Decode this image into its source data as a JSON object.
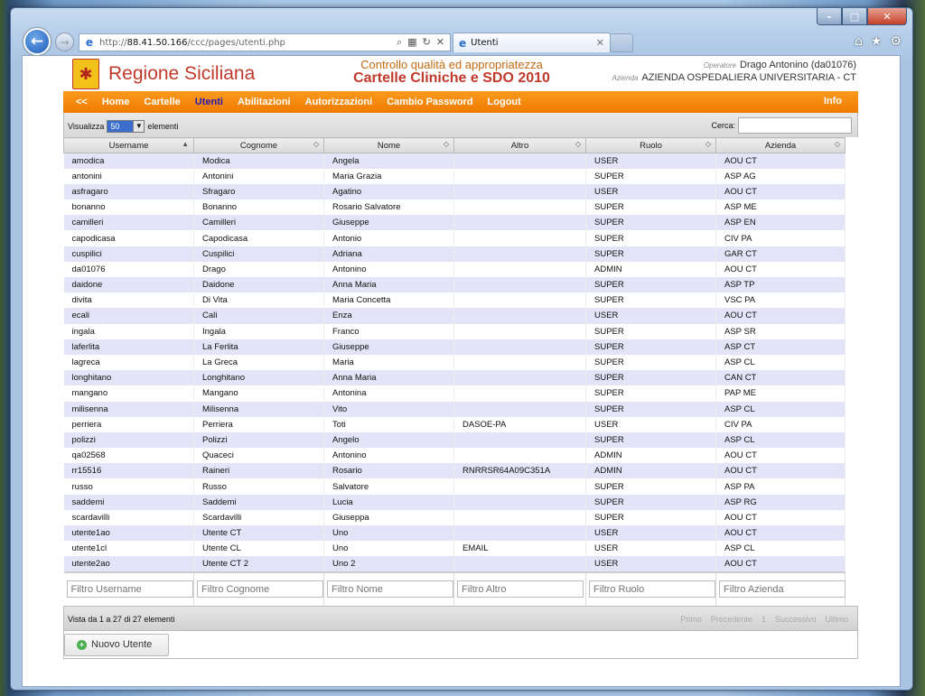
{
  "browser": {
    "url_prefix": "http://",
    "url_host": "88.41.50.166",
    "url_path": "/ccc/pages/utenti.php",
    "tab_title": "Utenti",
    "win_min": "–",
    "win_max": "□",
    "win_close": "✕"
  },
  "header": {
    "region": "Regione Siciliana",
    "title_line1": "Controllo qualità ed appropriatezza",
    "title_line2": "Cartelle Cliniche e SDO 2010",
    "operator_label": "Operatore",
    "operator": "Drago Antonino (da01076)",
    "azienda_label": "Azienda",
    "azienda": "AZIENDA OSPEDALIERA UNIVERSITARIA - CT"
  },
  "menu": {
    "items": [
      "<<",
      "Home",
      "Cartelle",
      "Utenti",
      "Abilitazioni",
      "Autorizzazioni",
      "Cambio Password",
      "Logout"
    ],
    "info": "Info"
  },
  "toolbar": {
    "show_label": "Visualizza",
    "page_size": "50",
    "elements_label": "elementi",
    "search_label": "Cerca:",
    "search_value": ""
  },
  "table": {
    "columns": [
      "Username",
      "Cognome",
      "Nome",
      "Altro",
      "Ruolo",
      "Azienda"
    ],
    "rows": [
      [
        "amodica",
        "Modica",
        "Angela",
        "",
        "USER",
        "AOU CT"
      ],
      [
        "antonini",
        "Antonini",
        "Maria Grazia",
        "",
        "SUPER",
        "ASP AG"
      ],
      [
        "asfragaro",
        "Sfragaro",
        "Agatino",
        "",
        "USER",
        "AOU CT"
      ],
      [
        "bonanno",
        "Bonanno",
        "Rosario Salvatore",
        "",
        "SUPER",
        "ASP ME"
      ],
      [
        "camilleri",
        "Camilleri",
        "Giuseppe",
        "",
        "SUPER",
        "ASP EN"
      ],
      [
        "capodicasa",
        "Capodicasa",
        "Antonio",
        "",
        "SUPER",
        "CIV PA"
      ],
      [
        "cuspilici",
        "Cuspilici",
        "Adriana",
        "",
        "SUPER",
        "GAR CT"
      ],
      [
        "da01076",
        "Drago",
        "Antonino",
        "",
        "ADMIN",
        "AOU CT"
      ],
      [
        "daidone",
        "Daidone",
        "Anna Maria",
        "",
        "SUPER",
        "ASP TP"
      ],
      [
        "divita",
        "Di Vita",
        "Maria Concetta",
        "",
        "SUPER",
        "VSC PA"
      ],
      [
        "ecali",
        "Calì",
        "Enza",
        "",
        "USER",
        "AOU CT"
      ],
      [
        "ingala",
        "Ingala",
        "Franco",
        "",
        "SUPER",
        "ASP SR"
      ],
      [
        "laferlita",
        "La Ferlita",
        "Giuseppe",
        "",
        "SUPER",
        "ASP CT"
      ],
      [
        "lagreca",
        "La Greca",
        "Maria",
        "",
        "SUPER",
        "ASP CL"
      ],
      [
        "longhitano",
        "Longhitano",
        "Anna Maria",
        "",
        "SUPER",
        "CAN CT"
      ],
      [
        "mangano",
        "Mangano",
        "Antonina",
        "",
        "SUPER",
        "PAP ME"
      ],
      [
        "milisenna",
        "Milisenna",
        "Vito",
        "",
        "SUPER",
        "ASP CL"
      ],
      [
        "perriera",
        "Perriera",
        "Toti",
        "DASOE-PA",
        "USER",
        "CIV PA"
      ],
      [
        "polizzi",
        "Polizzi",
        "Angelo",
        "",
        "SUPER",
        "ASP CL"
      ],
      [
        "qa02568",
        "Quaceci",
        "Antonino",
        "",
        "ADMIN",
        "AOU CT"
      ],
      [
        "rr15516",
        "Raineri",
        "Rosario",
        "RNRRSR64A09C351A",
        "ADMIN",
        "AOU CT"
      ],
      [
        "russo",
        "Russo",
        "Salvatore",
        "",
        "SUPER",
        "ASP PA"
      ],
      [
        "saddemi",
        "Saddemi",
        "Lucia",
        "",
        "SUPER",
        "ASP RG"
      ],
      [
        "scardavilli",
        "Scardavilli",
        "Giuseppa",
        "",
        "SUPER",
        "AOU CT"
      ],
      [
        "utente1ao",
        "Utente CT",
        "Uno",
        "",
        "USER",
        "AOU CT"
      ],
      [
        "utente1cl",
        "Utente CL",
        "Uno",
        "EMAIL",
        "USER",
        "ASP CL"
      ],
      [
        "utente2ao",
        "Utente CT 2",
        "Uno 2",
        "",
        "USER",
        "AOU CT"
      ]
    ],
    "filters": [
      "Filtro Username",
      "Filtro Cognome",
      "Filtro Nome",
      "Filtro Altro",
      "Filtro Ruolo",
      "Filtro Azienda"
    ]
  },
  "footer": {
    "info": "Vista da 1 a 27 di 27 elementi",
    "pager": [
      "Primo",
      "Precedente",
      "1",
      "Successivo",
      "Ultimo"
    ]
  },
  "new_user_button": "Nuovo Utente",
  "colors": {
    "menu_orange": "#f07b00",
    "active_menu": "#2a1ab2",
    "row_alt": "#e4e4f8",
    "region_red": "#c0392b"
  }
}
